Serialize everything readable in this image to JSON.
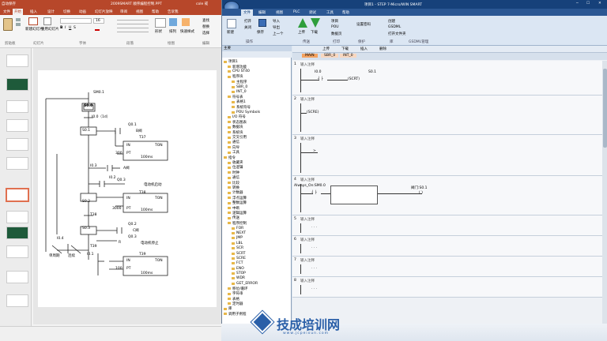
{
  "ppt": {
    "qat": "自动保存",
    "file_title": "2009SMART 顺序编程控制.PPT",
    "user": "cole 戒",
    "tabs": [
      "文件",
      "开始",
      "插入",
      "设计",
      "切换",
      "动画",
      "幻灯片放映",
      "审阅",
      "视图",
      "帮助",
      "告诉我"
    ],
    "active_tab": "开始",
    "groups": [
      "剪贴板",
      "幻灯片",
      "字体",
      "段落",
      "绘图",
      "编辑"
    ],
    "btn_new_slide": "新建幻灯片",
    "btn_reuse": "重用幻灯片",
    "btn_shape": "形状",
    "btn_arrange": "排列",
    "btn_quick": "快速样式",
    "btn_find": "查找",
    "btn_replace": "替换",
    "btn_select": "选择",
    "font_name": "",
    "font_size": "16",
    "slide_numbers": [
      "1",
      "2",
      "3",
      "4",
      "5",
      "6",
      "7",
      "8",
      "9",
      "10",
      "11",
      "12"
    ],
    "diagram": {
      "sm": "SM0.1",
      "s0_0": "S0.0",
      "i0_0": "I0.0（1d）",
      "s0_1": "S0.1",
      "q0_1": "Q0.1",
      "b_valve": "B阀",
      "t37": "T37",
      "in1": "IN",
      "ton1": "TON",
      "pt300": "300",
      "pt1": "PT",
      "ms100_1": "100ms",
      "i0_3": "I0.3",
      "a_valve": "A阀",
      "i0_2": "I0.2",
      "q0_3": "Q0.3",
      "motor_start": "电动机启动",
      "t38": "T38",
      "s0_2": "S0.2",
      "in2": "IN",
      "ton2": "TON",
      "pt3000": "3000",
      "pt2": "PT",
      "ms100_2": "100ms",
      "t38b": "T38",
      "s0_3": "S0.3",
      "q0_2": "Q0.2",
      "c_valve": "C阀",
      "q0_3b": "Q0.3",
      "motor_stop": "电动机停止",
      "i0_4": "I0.4",
      "t39": "T39",
      "i0_1": "I0.1",
      "t39b": "T39",
      "in3": "IN",
      "ton3": "TON",
      "pt100": "100",
      "pt3": "PT",
      "ms100_3": "100ms",
      "single_cycle": "单周期",
      "continuous": "连续",
      "r_label": "R"
    }
  },
  "mw": {
    "title": "项目1 - STEP 7-Micro/WIN SMART",
    "menu": [
      "文件",
      "编辑",
      "视图",
      "PLC",
      "调试",
      "工具",
      "帮助"
    ],
    "active_menu": "文件",
    "ribbon": {
      "new": "新建",
      "open": "打开",
      "close": "关闭",
      "save": "保存",
      "import": "导入",
      "export": "导出",
      "prev": "上一个",
      "upload": "上传",
      "download": "下载",
      "project": "项目",
      "pou": "POU",
      "data_page": "数据页",
      "set_password": "设置密码",
      "create": "创建",
      "gsdml": "GSDML",
      "bookmark": "打开文件夹",
      "group_labels": [
        "操作",
        "传送",
        "打印",
        "保护",
        "库",
        "GSDML管理"
      ]
    },
    "tree": {
      "header": "主要",
      "items": [
        "项目1",
        "新增功能",
        "CPU ST40",
        "程序块",
        "主程序",
        "SBR_0",
        "INT_0",
        "符号表",
        "表格1",
        "系统符号",
        "POU Symbols",
        "I/O 符号",
        "状态图表",
        "数据块",
        "系统块",
        "交叉引用",
        "通信",
        "向导",
        "工具",
        "指令",
        "收藏夹",
        "位逻辑",
        "时钟",
        "通信",
        "比较",
        "转换",
        "计数器",
        "浮点运算",
        "整数运算",
        "中断",
        "逻辑运算",
        "传送",
        "程序控制",
        "FOR",
        "NEXT",
        "JMP",
        "LBL",
        "SCR",
        "SCRT",
        "SCRE",
        "FCT",
        "ENO",
        "STOP",
        "WDR",
        "GET_ERROR",
        "移位/循环",
        "字符串",
        "表格",
        "定时器",
        "库",
        "调用子例程"
      ]
    },
    "editor_tabs": [
      "MAIN",
      "SBR_0",
      "INT_0"
    ],
    "toolbar_labels": [
      "上传",
      "下载",
      "插入",
      "删除"
    ],
    "networks": [
      {
        "num": "1",
        "comment": "输入注释",
        "contact": "I0.0",
        "coil": "S0.1",
        "coil_type": "SCRT"
      },
      {
        "num": "2",
        "comment": "输入注释",
        "coil_type": "SCRE"
      },
      {
        "num": "3",
        "comment": "输入注释"
      },
      {
        "num": "4",
        "comment": "输入注释",
        "contact": "Always_On:SM0.0",
        "coil": "阀门:S0.1"
      },
      {
        "num": "5",
        "comment": "输入注释"
      },
      {
        "num": "6",
        "comment": "输入注释"
      },
      {
        "num": "7",
        "comment": "输入注释"
      },
      {
        "num": "8",
        "comment": "输入注释"
      }
    ]
  },
  "watermark": {
    "main": "技成培训网",
    "sub": "www.jcpeixun.com"
  },
  "colors": {
    "ppt_red": "#c0392b",
    "mw_blue": "#16417a",
    "mw_ribbon": "#dbe6f3",
    "tree_bg": "#ffffff",
    "editor_bg": "#eef1f5",
    "wm_blue": "#2a5fa8"
  }
}
